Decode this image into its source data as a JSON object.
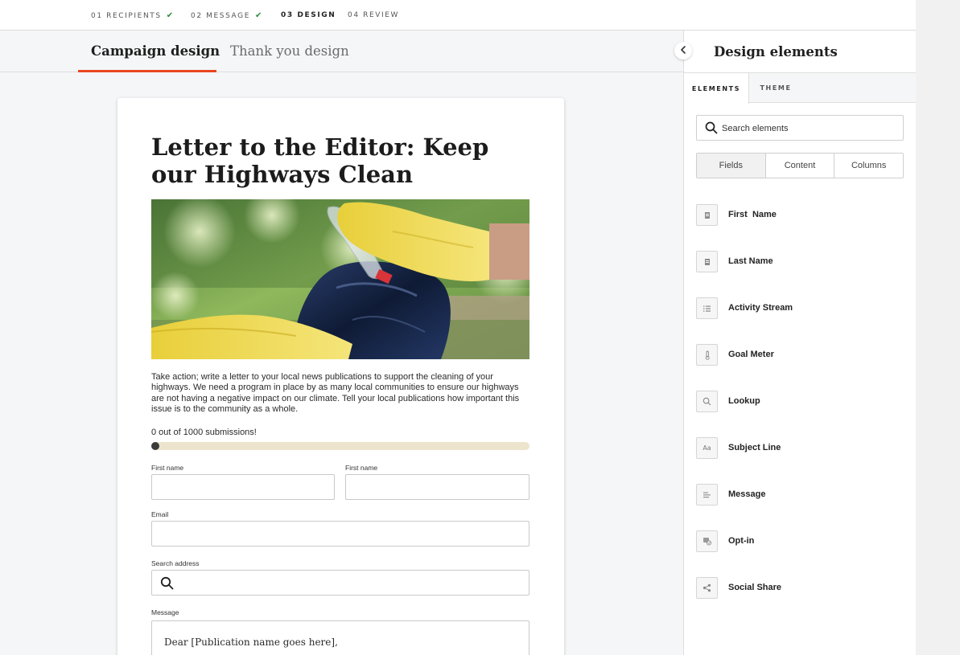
{
  "stepper": {
    "steps": [
      {
        "label": "01 RECIPIENTS",
        "done": true
      },
      {
        "label": "02 MESSAGE",
        "done": true
      },
      {
        "label": "03 DESIGN",
        "done": false
      },
      {
        "label": "04 REVIEW",
        "done": false
      }
    ],
    "check_glyph": "✔"
  },
  "tabs": [
    {
      "label": "Campaign design",
      "active": true
    },
    {
      "label": "Thank you design",
      "active": false
    }
  ],
  "accent_color": "#e8471f",
  "document": {
    "title": "Letter to the Editor: Keep our Highways Clean",
    "body": "Take action; write a letter to your local news publications to support the cleaning of your highways. We need a program in place by as many local communities to ensure our highways are not having a negative impact on our climate. Tell your local publications how important this issue is to the community as a whole.",
    "progress": {
      "label": "0 out of 1000 submissions!",
      "current": 0,
      "goal": 1000
    },
    "fields": {
      "first_name_label": "First name",
      "second_name_label": "First name",
      "email_label": "Email",
      "address_label": "Search address",
      "message_label": "Message",
      "message_value": "Dear [Publication name goes here],"
    }
  },
  "panel": {
    "title": "Design elements",
    "tabs": [
      {
        "label": "ELEMENTS",
        "active": true
      },
      {
        "label": "THEME",
        "active": false
      }
    ],
    "search_placeholder": "Search elements",
    "segments": [
      {
        "label": "Fields",
        "active": true
      },
      {
        "label": "Content",
        "active": false
      },
      {
        "label": "Columns",
        "active": false
      }
    ],
    "elements": [
      {
        "label": "First  Name",
        "icon": "id-card-icon"
      },
      {
        "label": "Last Name",
        "icon": "id-card-icon"
      },
      {
        "label": "Activity Stream",
        "icon": "list-icon"
      },
      {
        "label": "Goal Meter",
        "icon": "thermometer-icon"
      },
      {
        "label": "Lookup",
        "icon": "magnifier-icon"
      },
      {
        "label": "Subject Line",
        "icon": "text-icon",
        "glyph": "Aa"
      },
      {
        "label": "Message",
        "icon": "paragraph-icon"
      },
      {
        "label": "Opt-in",
        "icon": "opt-in-icon"
      },
      {
        "label": "Social Share",
        "icon": "share-icon"
      }
    ]
  }
}
